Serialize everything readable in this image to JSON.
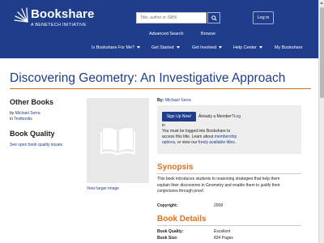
{
  "header": {
    "logo": {
      "name": "Bookshare",
      "tagline": "A BENETECH INITIATIVE"
    },
    "search": {
      "placeholder": "Title, author or ISBN"
    },
    "login_label": "Log in",
    "sublinks": [
      "Advanced Search",
      "Browse"
    ],
    "nav": [
      {
        "label": "Is Bookshare For Me?",
        "caret": true
      },
      {
        "label": "Get Started",
        "caret": true
      },
      {
        "label": "Get Involved",
        "caret": true
      },
      {
        "label": "Help Center",
        "caret": true
      },
      {
        "label": "My Bookshare",
        "caret": false
      }
    ]
  },
  "book": {
    "title": "Discovering Geometry: An Investigative Approach",
    "by_label": "By:",
    "author": "Michael Serra",
    "view_large": "View larger image"
  },
  "sidebar": {
    "other_books_heading": "Other Books",
    "other_books_by_prefix": "by",
    "other_books_author": "Michael Serra",
    "other_books_in_prefix": "in",
    "other_books_category": "Textbooks",
    "quality_heading": "Book Quality",
    "quality_link": "See open book quality issues"
  },
  "login_box": {
    "signup_label": "Sign Up Now!",
    "already_member": "Already a Member?",
    "login_link_part1": "Log",
    "login_link_part2": "in",
    "line1": "You must be logged into Bookshare to",
    "line2_prefix": "access this title. Learn about",
    "membership_link_1": "membership",
    "membership_link_2": "options",
    "line3_mid": ", or view our",
    "free_titles_link": "freely available titles",
    "line3_end": "."
  },
  "synopsis": {
    "heading": "Synopsis",
    "lines": [
      "This book introduces students to reasoning strategies that help them",
      "explain their discoveries in Geometry and enable them to justify their",
      "conjectures through proof."
    ],
    "copyright_label": "Copyright:",
    "copyright_value": "2008"
  },
  "details": {
    "heading": "Book Details",
    "rows": [
      {
        "label": "Book Quality:",
        "value": "Excellent"
      },
      {
        "label": "Book Size:",
        "value": "834 Pages"
      }
    ]
  },
  "colors": {
    "brand_blue": "#1f3d8a",
    "accent_orange": "#e46f1a"
  },
  "icons": {
    "search": "search-icon",
    "book": "open-book-icon",
    "logo": "sunburst-logo-icon"
  }
}
